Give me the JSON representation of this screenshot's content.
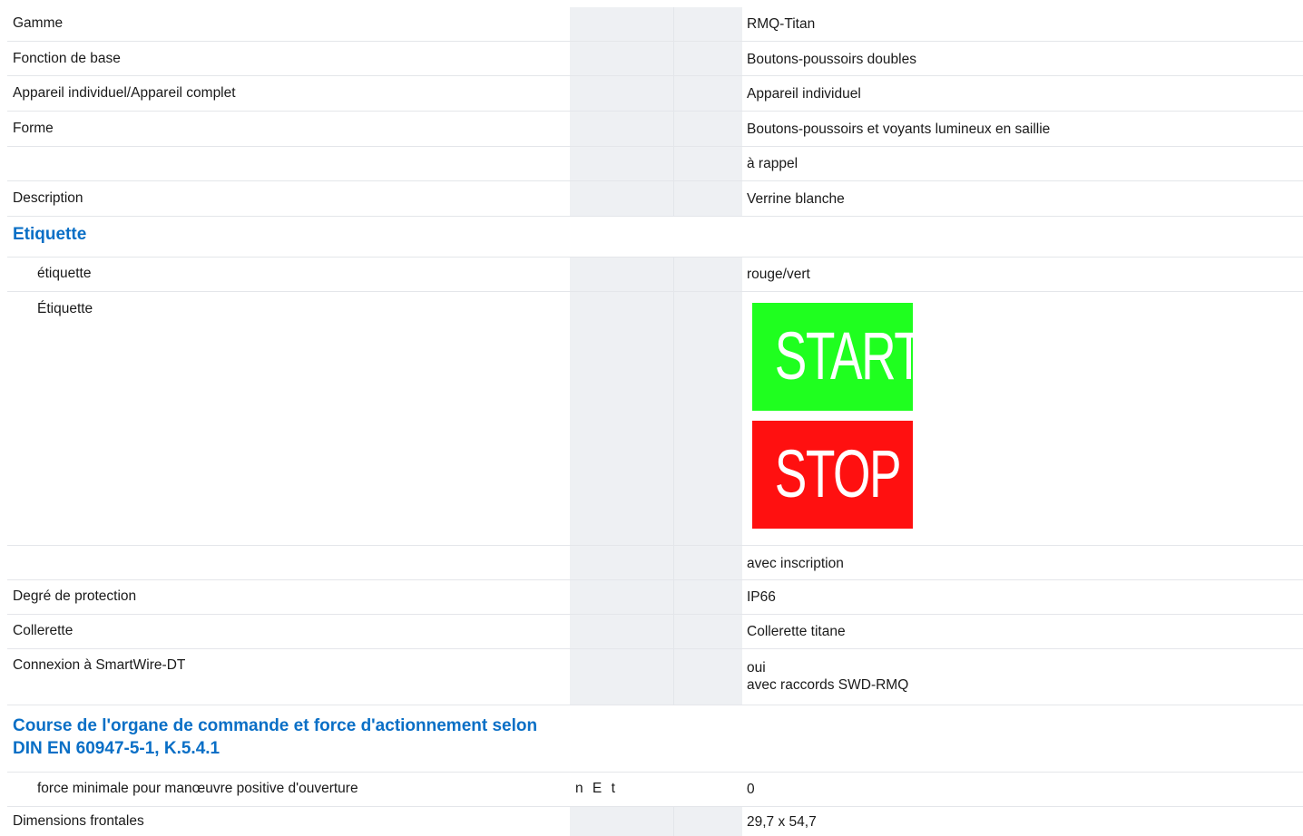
{
  "rows": {
    "gamme": {
      "label": "Gamme",
      "value": "RMQ-Titan"
    },
    "fonction": {
      "label": "Fonction de base",
      "value": "Boutons-poussoirs doubles"
    },
    "appareil": {
      "label": "Appareil individuel/Appareil complet",
      "value": "Appareil individuel"
    },
    "forme": {
      "label": "Forme",
      "value": "Boutons-poussoirs et voyants lumineux en saillie"
    },
    "forme2": {
      "label": "",
      "value": "à rappel"
    },
    "description": {
      "label": "Description",
      "value": "Verrine blanche"
    },
    "etiquette_heading": {
      "label": "Etiquette"
    },
    "etiquette": {
      "label": "étiquette",
      "value": "rouge/vert"
    },
    "etiquette_img": {
      "label": "Étiquette",
      "start_text": "START",
      "stop_text": "STOP",
      "start_color": "#1fff1f",
      "stop_color": "#ff1010"
    },
    "inscription": {
      "label": "",
      "value": "avec inscription"
    },
    "protection": {
      "label": "Degré de protection",
      "value": "IP66"
    },
    "collerette": {
      "label": "Collerette",
      "value": "Collerette titane"
    },
    "smartwire": {
      "label": "Connexion à SmartWire-DT",
      "value_line1": "oui",
      "value_line2": "avec raccords SWD-RMQ"
    },
    "course_heading": {
      "label": "Course de l'organe de commande et force d'actionnement selon DIN EN 60947-5-1, K.5.4.1"
    },
    "force": {
      "label": "force minimale pour manœuvre positive d'ouverture",
      "unit": "n E t",
      "value": "0"
    },
    "dimensions": {
      "label": "Dimensions frontales",
      "value": "29,7 x 54,7"
    }
  },
  "colors": {
    "heading": "#0a6fc6",
    "band": "#eef0f3",
    "row_border": "#e4e6ea"
  }
}
